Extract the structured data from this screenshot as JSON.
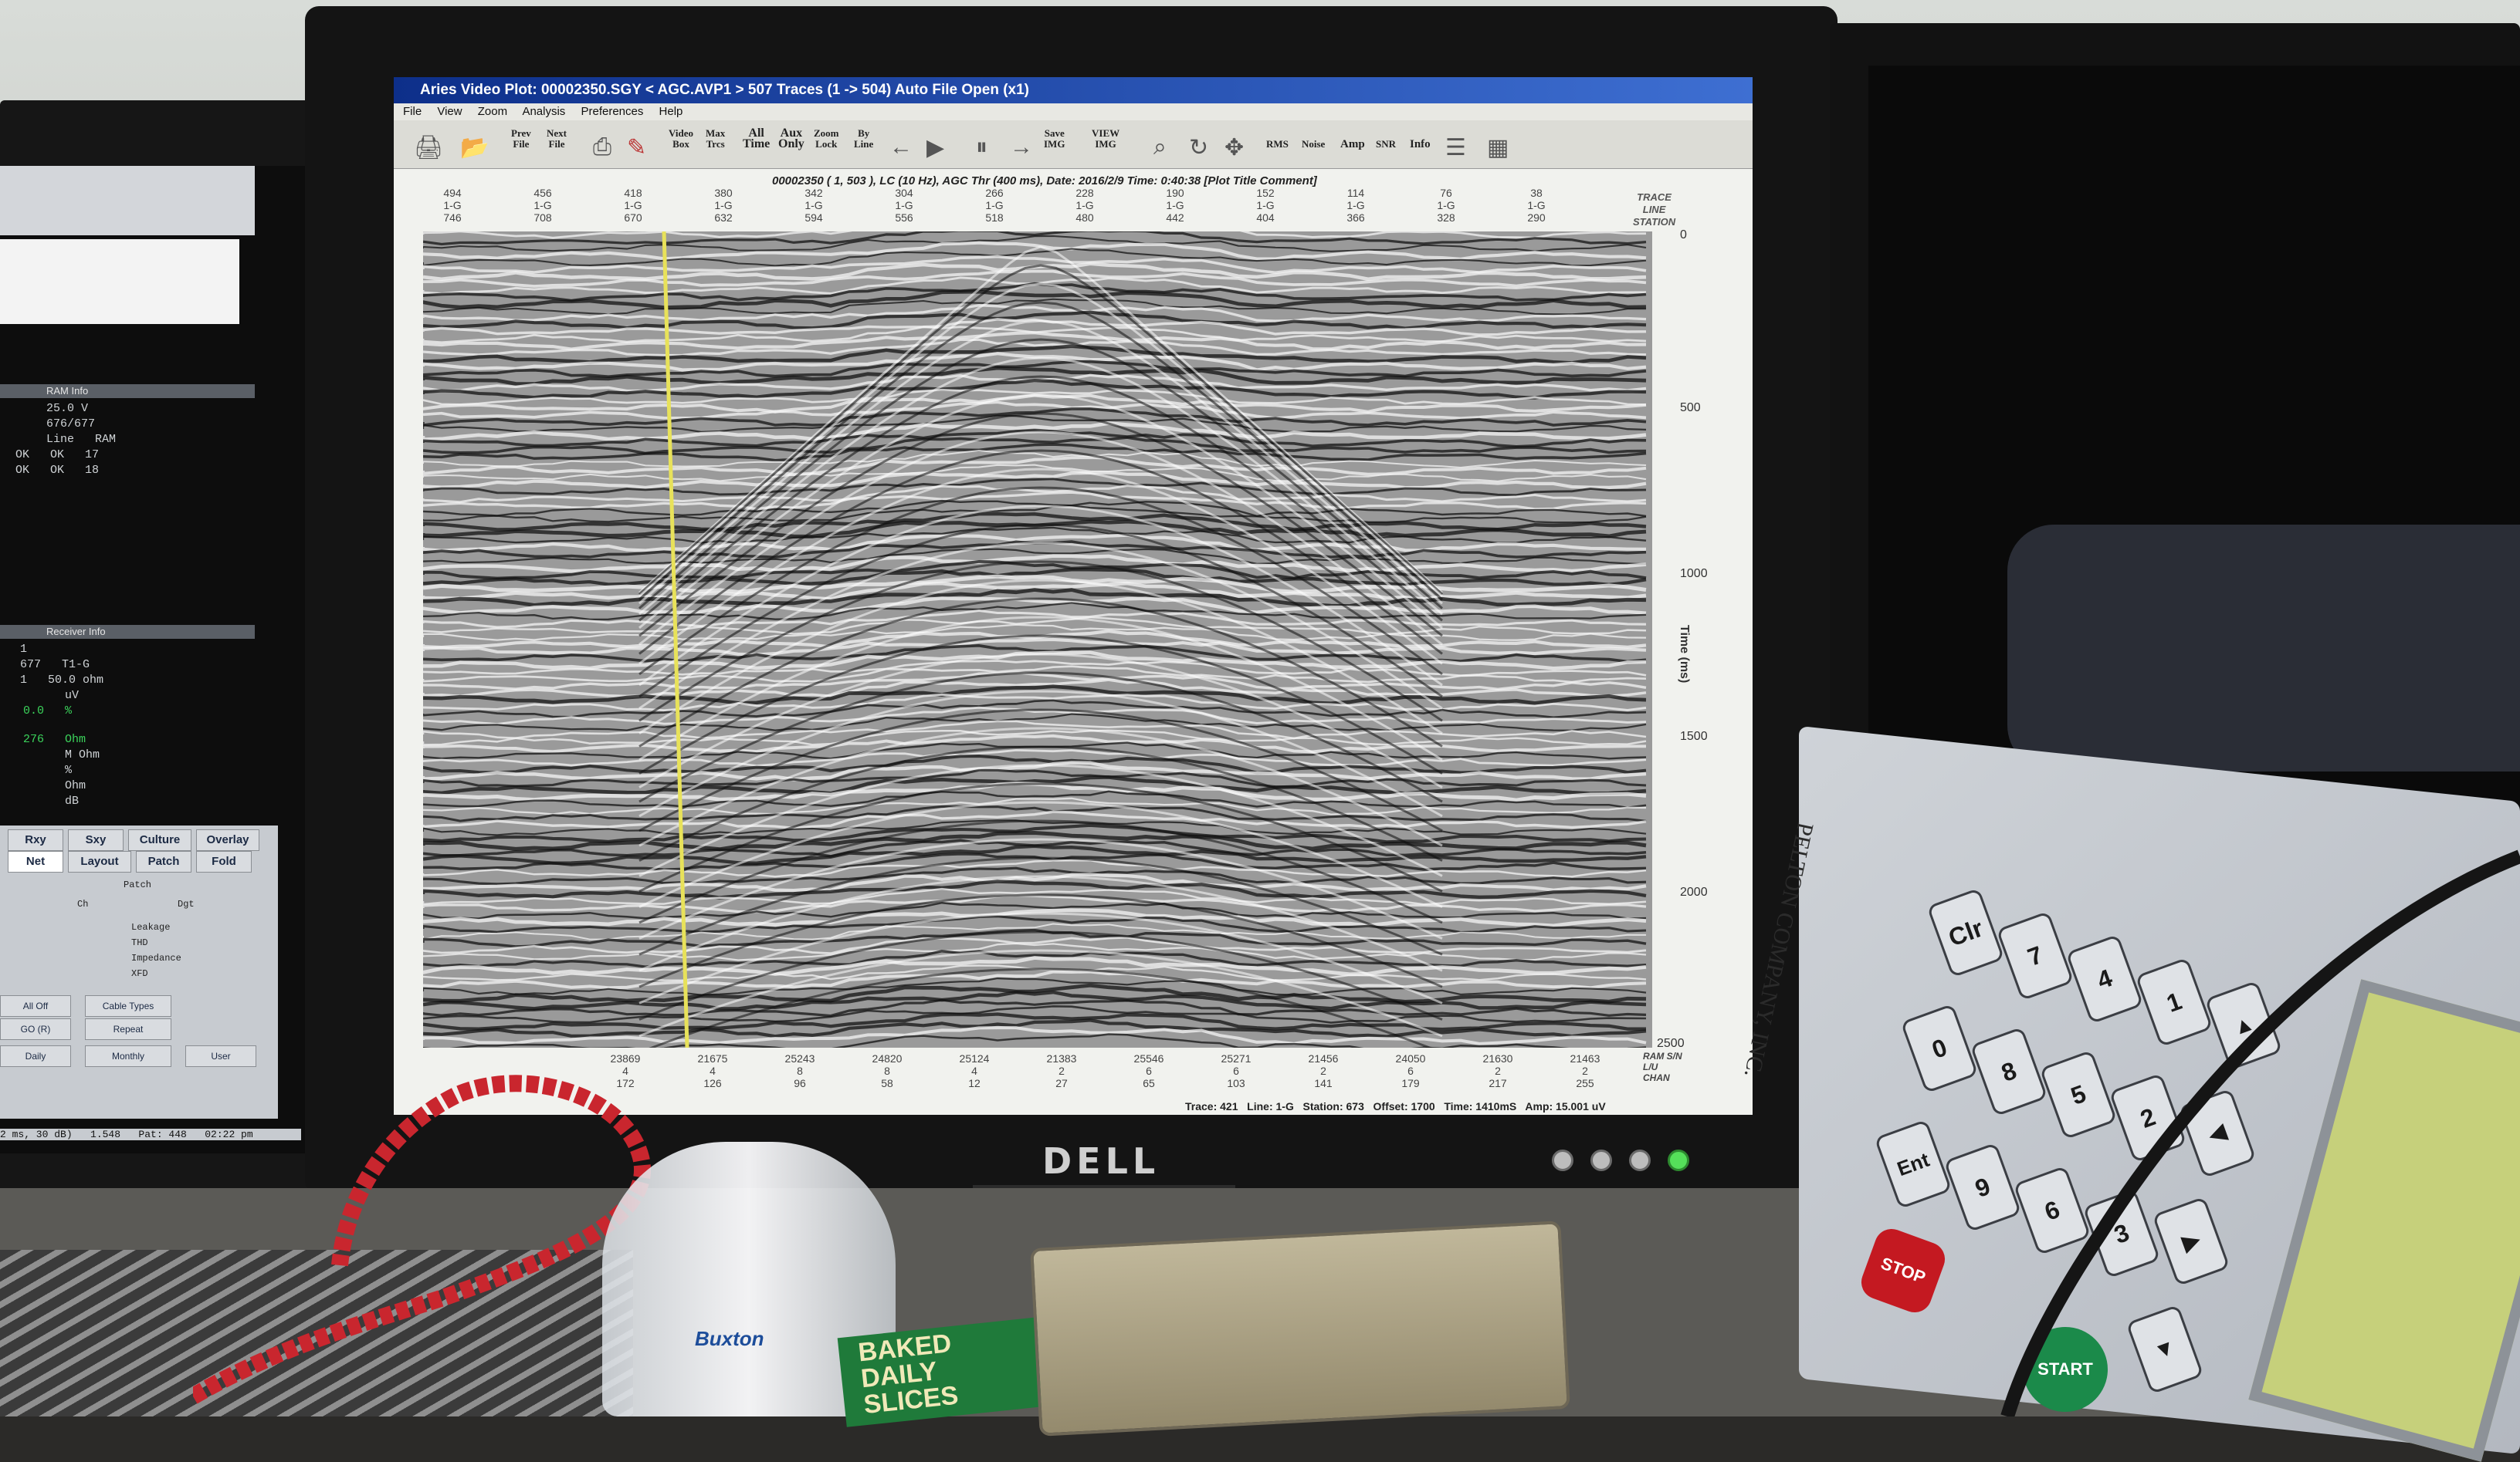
{
  "app": {
    "title": "Aries Video Plot: 00002350.SGY < AGC.AVP1 > 507 Traces (1 -> 504) Auto File Open (x1)",
    "menu": [
      "File",
      "View",
      "Zoom",
      "Analysis",
      "Preferences",
      "Help"
    ],
    "toolbar": [
      "Prev\nFile",
      "Next\nFile",
      "Video\nBox",
      "Max\nTrcs",
      "All\nTime",
      "Aux\nOnly",
      "Zoom\nLock",
      "By\nLine",
      "Save\nIMG",
      "VIEW\nIMG",
      "RMS",
      "Noise",
      "Amp",
      "SNR",
      "Info"
    ],
    "plot_header": "00002350 ( 1, 503 ), LC (10 Hz), AGC Thr (400 ms), Date: 2016/2/9 Time: 0:40:38 [Plot Title Comment]",
    "top_axis": {
      "traces": [
        "494",
        "456",
        "418",
        "380",
        "342",
        "304",
        "266",
        "228",
        "190",
        "152",
        "114",
        "76",
        "38"
      ],
      "lines": [
        "1-G",
        "1-G",
        "1-G",
        "1-G",
        "1-G",
        "1-G",
        "1-G",
        "1-G",
        "1-G",
        "1-G",
        "1-G",
        "1-G",
        "1-G"
      ],
      "stations": [
        "746",
        "708",
        "670",
        "632",
        "594",
        "556",
        "518",
        "480",
        "442",
        "404",
        "366",
        "328",
        "290"
      ],
      "label": "TRACE\nLINE\nSTATION"
    },
    "time_axis": {
      "ticks": [
        "0",
        "500",
        "1000",
        "1500",
        "2000",
        "2500"
      ],
      "label": "Time (ms)"
    },
    "bottom_axis": {
      "values": [
        "23869",
        "21675",
        "25243",
        "24820",
        "25124",
        "21383",
        "25546",
        "25271",
        "21456",
        "24050",
        "21630",
        "21463"
      ],
      "row2": [
        "4",
        "4",
        "8",
        "8",
        "4",
        "2",
        "6",
        "6",
        "2",
        "6",
        "2",
        "2"
      ],
      "row3": [
        "172",
        "126",
        "96",
        "58",
        "12",
        "27",
        "65",
        "103",
        "141",
        "179",
        "217",
        "255"
      ],
      "label": "RAM S/N\nL/U\nCHAN"
    },
    "status": "Trace: 421   Line: 1-G   Station: 673   Offset: 1700   Time: 1410mS   Amp: 15.001 uV"
  },
  "left_panel": {
    "ram_info_title": "RAM Info",
    "ram_rows": [
      "25.0 V",
      "676/677",
      "Line   RAM",
      "OK   OK   17",
      "OK   OK   18"
    ],
    "receiver_title": "Receiver Info",
    "receiver_rows": [
      "1",
      "677   T1-G",
      "1   50.0 ohm",
      "uV",
      "0.0   %",
      "276   Ohm",
      "M Ohm",
      "%",
      "Ohm",
      "dB"
    ],
    "tabs_row1": [
      "Rxy",
      "Sxy",
      "Culture",
      "Overlay"
    ],
    "tabs_row2": [
      "Net",
      "Layout",
      "Patch",
      "Fold"
    ],
    "options": [
      "Patch",
      "Ch",
      "Dgt",
      "Leakage",
      "THD",
      "Impedance",
      "XFD"
    ],
    "buttons": [
      "All Off",
      "Cable Types",
      "GO (R)",
      "Repeat",
      "Daily",
      "Monthly",
      "User"
    ],
    "footer": "2 ms, 30 dB)   1.548   Pat: 448   02:22 pm"
  },
  "monitor": {
    "brand": "DELL"
  },
  "device": {
    "label": "PELTON COMPANY, INC.",
    "keys": [
      "Clr",
      "7",
      "4",
      "1",
      "0",
      "8",
      "5",
      "2",
      "Ent",
      "9",
      "6",
      "3"
    ],
    "stop": "STOP",
    "start": "START"
  },
  "desk": {
    "bottle_label": "Buxton",
    "snack_label": "BAKED\nDAILY\nSLICES"
  },
  "colors": {
    "title_bar": "#0d2f8a",
    "screen_bg": "#f1f2ee",
    "stop": "#c41921",
    "start": "#1b8a4a",
    "lcd": "#c6d07b"
  }
}
